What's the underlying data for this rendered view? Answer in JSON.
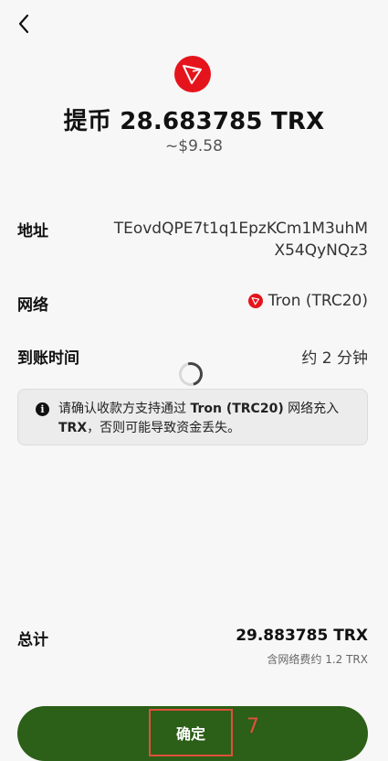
{
  "header": {
    "back_icon": "chevron-left-icon"
  },
  "token": {
    "logo_icon": "tron-logo-icon",
    "brand_color": "#e5141c"
  },
  "title": "提币 28.683785 TRX",
  "fiat_value": "~$9.58",
  "details": {
    "address_label": "地址",
    "address_value": "TEovdQPE7t1q1EpzKCm1M3uhMX54QyNQz3",
    "network_label": "网络",
    "network_value": "Tron (TRC20)",
    "arrival_label": "到账时间",
    "arrival_value": "约 2 分钟"
  },
  "notice": {
    "icon": "info-icon",
    "text_before": "请确认收款方支持通过 ",
    "bold_network": "Tron (TRC20)",
    "text_middle": " 网络充入 ",
    "bold_asset": "TRX",
    "text_after": "，否则可能导致资金丢失。"
  },
  "total": {
    "label": "总计",
    "amount": "29.883785 TRX",
    "fee_note": "含网络费约 1.2 TRX"
  },
  "confirm_button": {
    "label": "确定",
    "color": "#2c5f18"
  },
  "annotation": {
    "marker": "7",
    "color": "#e0503a"
  }
}
